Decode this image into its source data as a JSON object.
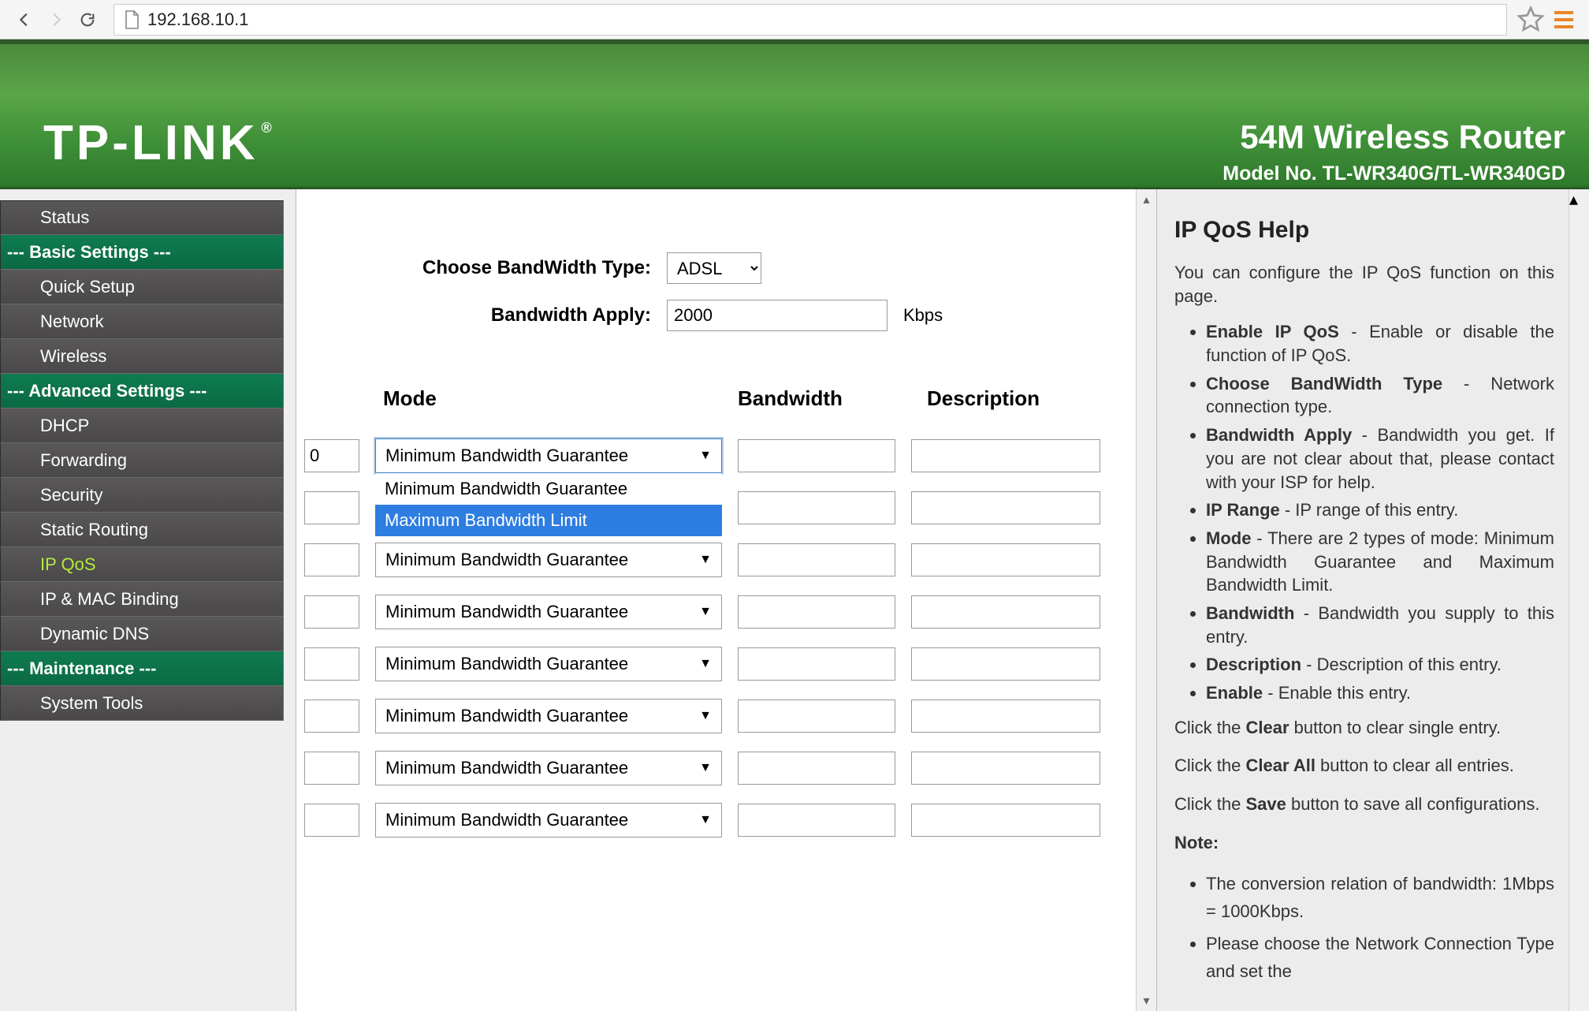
{
  "browser": {
    "url": "192.168.10.1"
  },
  "header": {
    "brand": "TP-LINK",
    "product_title": "54M Wireless Router",
    "model": "Model No. TL-WR340G/TL-WR340GD"
  },
  "sidebar": {
    "items": [
      {
        "label": "Status",
        "type": "item"
      },
      {
        "label": "--- Basic Settings ---",
        "type": "section"
      },
      {
        "label": "Quick Setup",
        "type": "item"
      },
      {
        "label": "Network",
        "type": "item"
      },
      {
        "label": "Wireless",
        "type": "item"
      },
      {
        "label": "--- Advanced Settings ---",
        "type": "section"
      },
      {
        "label": "DHCP",
        "type": "item"
      },
      {
        "label": "Forwarding",
        "type": "item"
      },
      {
        "label": "Security",
        "type": "item"
      },
      {
        "label": "Static Routing",
        "type": "item"
      },
      {
        "label": "IP QoS",
        "type": "item",
        "active": true
      },
      {
        "label": "IP & MAC Binding",
        "type": "item"
      },
      {
        "label": "Dynamic DNS",
        "type": "item"
      },
      {
        "label": "--- Maintenance ---",
        "type": "section"
      },
      {
        "label": "System Tools",
        "type": "item"
      }
    ]
  },
  "form": {
    "bw_type_label": "Choose BandWidth Type:",
    "bw_type_value": "ADSL",
    "bw_apply_label": "Bandwidth Apply:",
    "bw_apply_value": "2000",
    "bw_apply_unit": "Kbps",
    "columns": {
      "mode": "Mode",
      "bandwidth": "Bandwidth",
      "description": "Description"
    },
    "mode_default": "Minimum Bandwidth Guarantee",
    "mode_options": [
      "Minimum Bandwidth Guarantee",
      "Maximum Bandwidth Limit"
    ],
    "rows": [
      {
        "partial": "0",
        "open": true
      },
      {
        "partial": ""
      },
      {
        "partial": ""
      },
      {
        "partial": ""
      },
      {
        "partial": ""
      },
      {
        "partial": ""
      },
      {
        "partial": ""
      },
      {
        "partial": ""
      }
    ]
  },
  "help": {
    "title": "IP QoS Help",
    "intro": "You can configure the IP QoS function on this page.",
    "bullets": [
      {
        "term": "Enable IP QoS",
        "text": " - Enable or disable the function of IP QoS."
      },
      {
        "term": "Choose BandWidth Type",
        "text": " - Network connection type."
      },
      {
        "term": "Bandwidth Apply",
        "text": " - Bandwidth you get. If you are not clear about that, please contact with your ISP for help."
      },
      {
        "term": "IP Range",
        "text": " - IP range of this entry."
      },
      {
        "term": "Mode",
        "text": " - There are 2 types of mode: Minimum Bandwidth Guarantee and Maximum Bandwidth Limit."
      },
      {
        "term": "Bandwidth",
        "text": " - Bandwidth you supply to this entry."
      },
      {
        "term": "Description",
        "text": " - Description of this entry."
      },
      {
        "term": "Enable",
        "text": " - Enable this entry."
      }
    ],
    "clear_line": {
      "pre": "Click the ",
      "b": "Clear",
      "post": " button to clear single entry."
    },
    "clearall_line": {
      "pre": "Click the ",
      "b": "Clear All",
      "post": " button to clear all entries."
    },
    "save_line": {
      "pre": "Click the ",
      "b": "Save",
      "post": " button to save all configurations."
    },
    "note_label": "Note:",
    "note_bullets": [
      "The conversion relation of bandwidth: 1Mbps = 1000Kbps.",
      "Please choose the Network Connection Type and set the"
    ]
  }
}
